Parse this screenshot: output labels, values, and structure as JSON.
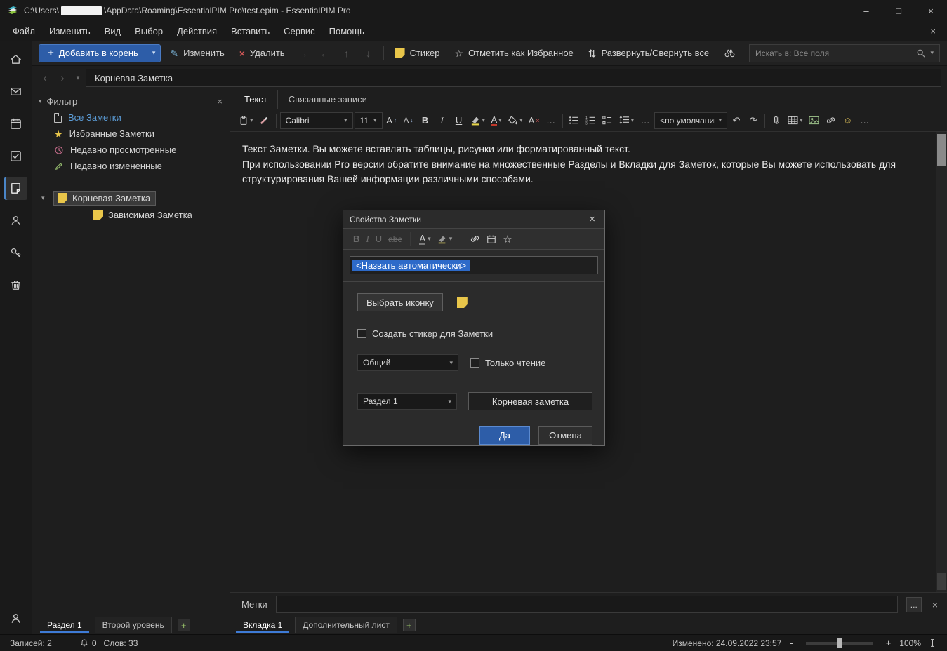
{
  "colors": {
    "accent_blue": "#2d5da8",
    "selection_blue": "#2d6ac9",
    "note_yellow": "#e9c64a",
    "delete_red": "#d05757",
    "filter_link_blue": "#5b9bd5"
  },
  "titlebar": {
    "path_prefix": "C:\\Users\\",
    "path_suffix": "\\AppData\\Roaming\\EssentialPIM Pro\\test.epim - EssentialPIM Pro",
    "minimize": "–",
    "maximize": "□",
    "close": "×"
  },
  "menubar": {
    "items": [
      "Файл",
      "Изменить",
      "Вид",
      "Выбор",
      "Действия",
      "Вставить",
      "Сервис",
      "Помощь"
    ],
    "close": "×"
  },
  "toolbar": {
    "add_root_label": "Добавить в корень",
    "edit_label": "Изменить",
    "delete_label": "Удалить",
    "sticker_label": "Стикер",
    "favorite_label": "Отметить как Избранное",
    "expand_label": "Развернуть/Свернуть все",
    "search_placeholder": "Искать в: Все поля"
  },
  "navbar": {
    "current_note": "Корневая Заметка"
  },
  "sidebar": {
    "filter_title": "Фильтр",
    "filters": [
      "Все Заметки",
      "Избранные Заметки",
      "Недавно просмотренные",
      "Недавно измененные"
    ],
    "tree_root": "Корневая Заметка",
    "tree_child": "Зависимая Заметка",
    "bottom_tabs": [
      "Раздел 1",
      "Второй уровень"
    ],
    "add_tab": "+"
  },
  "content": {
    "tabs": [
      "Текст",
      "Связанные записи"
    ],
    "format_toolbar": {
      "font": "Calibri",
      "font_size": "11",
      "paragraph_style": "<по умолчанию"
    },
    "editor_lines": [
      "Текст Заметки. Вы можете вставлять таблицы, рисунки или форматированный текст.",
      "При использовании Pro версии обратите внимание на множественные Разделы и Вкладки для Заметок, которые Вы можете использовать для",
      "структурирования Вашей информации различными способами."
    ],
    "tags_label": "Метки",
    "tags_more": "...",
    "bottom_tabs": [
      "Вкладка 1",
      "Дополнительный лист"
    ],
    "add_tab": "+"
  },
  "dialog": {
    "title": "Свойства Заметки",
    "close": "×",
    "name_selected_text": "<Назвать автоматически>",
    "choose_icon_button": "Выбрать иконку",
    "sticker_checkbox_label": "Создать стикер для Заметки",
    "type_select_value": "Общий",
    "readonly_checkbox_label": "Только чтение",
    "section_select_value": "Раздел 1",
    "note_name_value": "Корневая заметка",
    "ok_button": "Да",
    "cancel_button": "Отмена"
  },
  "statusbar": {
    "records": "Записей: 2",
    "notifications_count": "0",
    "words": "Слов: 33",
    "modified": "Изменено: 24.09.2022 23:57",
    "zoom_out": "-",
    "zoom_in": "+",
    "zoom_level": "100%"
  },
  "glyphs": {
    "caret": "▾",
    "back": "‹",
    "forward": "›",
    "bold": "B",
    "italic": "I",
    "underline": "U",
    "strike_sample": "abc",
    "letter_a": "A",
    "more": "…",
    "undo": "↶",
    "redo": "↷",
    "arrow_right": "→",
    "arrow_left": "←",
    "arrow_up": "↑",
    "arrow_down": "↓",
    "expand_arrows": "⇅",
    "star": "☆",
    "star_filled": "★",
    "pencil": "✎",
    "smiley": "☺",
    "close": "×",
    "plus": "+",
    "tasks_box": "☑"
  }
}
